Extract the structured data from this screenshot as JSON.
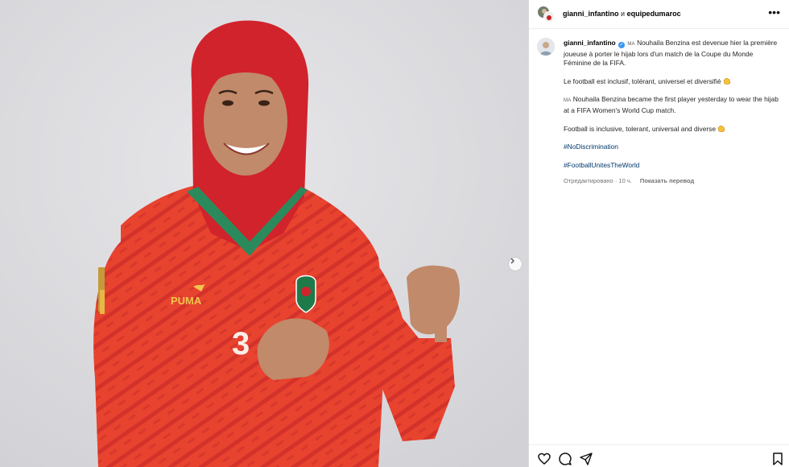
{
  "header": {
    "user1": "gianni_infantino",
    "conjunction": "и",
    "user2": "equipedumaroc",
    "more_icon": "more-horizontal-icon"
  },
  "caption": {
    "username": "gianni_infantino",
    "flag1": "MA",
    "para1": "Nouhaila Benzina est devenue hier la première joueuse à porter le hijab lors d'un match de la Coupe du Monde Féminine de la FIFA.",
    "para2": "Le football est inclusif, tolérant, universel et diversifié",
    "flag2": "MA",
    "para3": "Nouhaila Benzina became the first player yesterday to wear the hijab at a FIFA Women's World Cup match.",
    "para4": "Football is inclusive, tolerant, universal and diverse",
    "hashtag1": "#NoDiscrimination",
    "hashtag2": "#FootballUnitesTheWorld"
  },
  "meta": {
    "edited": "Отредактировано",
    "dot": "·",
    "time": "10 ч.",
    "translate": "Показать перевод"
  },
  "photo": {
    "jersey_brand": "PUMA",
    "jersey_number": "3"
  },
  "colors": {
    "jersey_red": "#e8432f",
    "hijab_red": "#d1232b",
    "collar_green": "#2b8a5c",
    "background": "#dcdcdf",
    "hashtag": "#00376b"
  },
  "icons": [
    "heart-icon",
    "comment-icon",
    "share-icon",
    "bookmark-icon",
    "chevron-right-icon",
    "verified-badge-icon",
    "clapping-hands-icon"
  ]
}
